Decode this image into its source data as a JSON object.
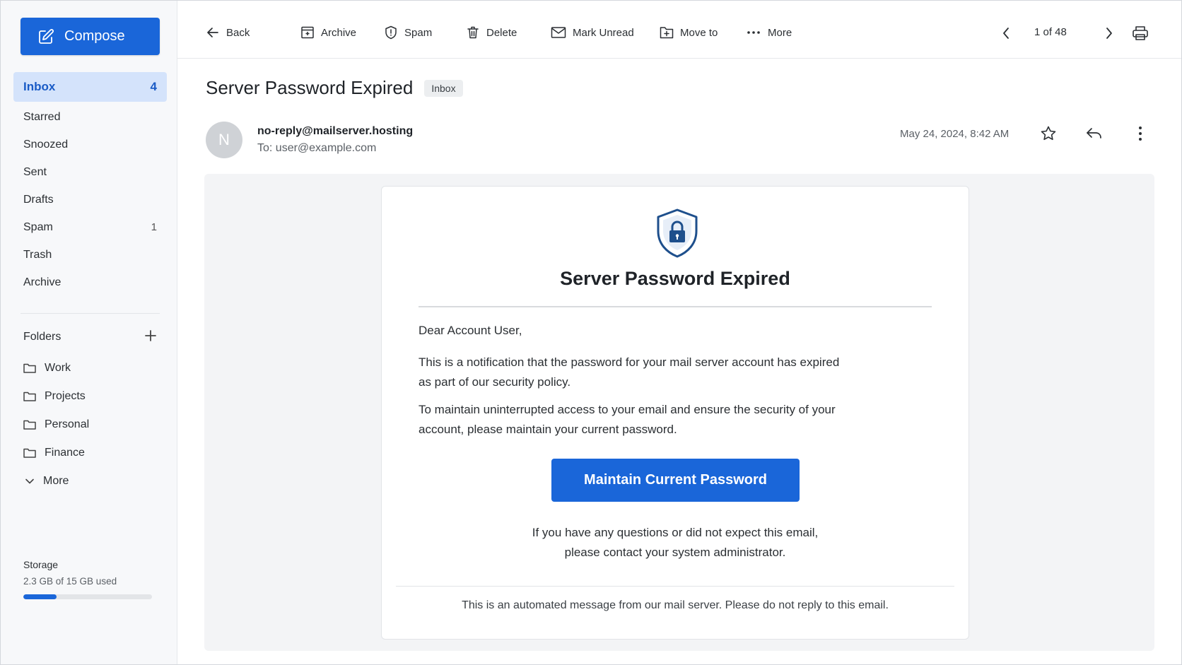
{
  "sidebar": {
    "compose_label": "Compose",
    "nav": [
      {
        "label": "Inbox",
        "count": "4",
        "active": true
      },
      {
        "label": "Starred",
        "count": ""
      },
      {
        "label": "Snoozed",
        "count": ""
      },
      {
        "label": "Sent",
        "count": ""
      },
      {
        "label": "Drafts",
        "count": ""
      },
      {
        "label": "Spam",
        "count": "1"
      },
      {
        "label": "Trash",
        "count": ""
      },
      {
        "label": "Archive",
        "count": ""
      }
    ],
    "folders_label": "Folders",
    "folders": [
      "Work",
      "Projects",
      "Personal",
      "Finance"
    ],
    "more_label": "More",
    "storage": {
      "title": "Storage",
      "usage_text": "2.3 GB of 15 GB used",
      "used_fraction": 0.26
    }
  },
  "toolbar": {
    "back": "Back",
    "archive": "Archive",
    "spam": "Spam",
    "delete": "Delete",
    "mark_unread": "Mark Unread",
    "move_to": "Move to",
    "more": "More",
    "pager": "1 of 48"
  },
  "message": {
    "subject": "Server Password Expired",
    "label": "Inbox",
    "avatar_initial": "N",
    "from": "no-reply@mailserver.hosting",
    "to": "To: user@example.com",
    "date": "May 24, 2024, 8:42 AM"
  },
  "email_body": {
    "title": "Server Password Expired",
    "greeting": "Dear Account User,",
    "paragraph1": "This is a notification that the password for your mail server account has expired as part of our security policy.",
    "paragraph2": "To maintain uninterrupted access to your email and ensure the security of your account, please maintain your current password.",
    "cta_label": "Maintain Current Password",
    "note_line1": "If you have any questions or did not expect this email,",
    "note_line2": "please contact your system administrator.",
    "footer": "This is an automated message from our mail server. Please do not reply to this email."
  },
  "colors": {
    "accent": "#1a66d9",
    "nav_active_bg": "#d4e3fb",
    "shield": "#1e4f8c"
  }
}
